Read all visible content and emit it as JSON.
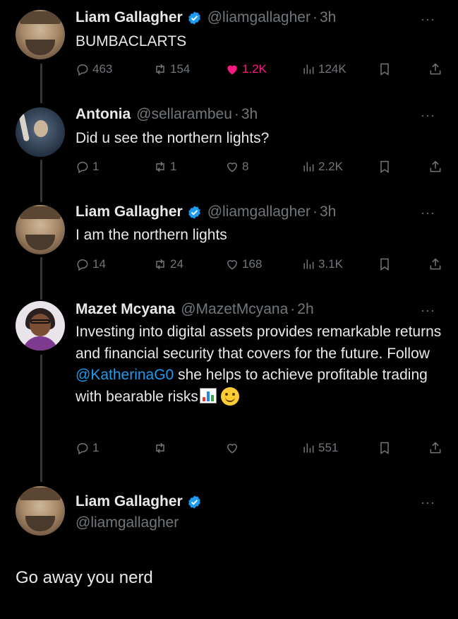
{
  "tweets": [
    {
      "name": "Liam Gallagher",
      "verified": true,
      "handle": "@liamgallagher",
      "time": "3h",
      "text": "BUMBACLARTS",
      "actions": {
        "replies": "463",
        "retweets": "154",
        "likes": "1.2K",
        "views": "124K",
        "liked": true
      }
    },
    {
      "name": "Antonia",
      "verified": false,
      "handle": "@sellarambeu",
      "time": "3h",
      "text": "Did u see the northern lights?",
      "actions": {
        "replies": "1",
        "retweets": "1",
        "likes": "8",
        "views": "2.2K",
        "liked": false
      }
    },
    {
      "name": "Liam Gallagher",
      "verified": true,
      "handle": "@liamgallagher",
      "time": "3h",
      "text": "I am the northern lights",
      "actions": {
        "replies": "14",
        "retweets": "24",
        "likes": "168",
        "views": "3.1K",
        "liked": false
      }
    },
    {
      "name": "Mazet Mcyana",
      "verified": false,
      "handle": "@MazetMcyana",
      "time": "2h",
      "text_before_link": "Investing into digital assets provides remarkable returns and financial security that covers for the future. Follow ",
      "link": "@KatherinaG0",
      "text_after_link": " she helps to achieve profitable trading with bearable risks",
      "emojis": [
        "chart-emoji",
        "smiling-face-emoji"
      ],
      "actions": {
        "replies": "1",
        "retweets": "",
        "likes": "",
        "views": "551",
        "liked": false
      }
    }
  ],
  "final_tweet": {
    "name": "Liam Gallagher",
    "verified": true,
    "handle": "@liamgallagher",
    "text": "Go away you nerd"
  },
  "more_label": "···",
  "dot": "·",
  "colors": {
    "background": "#000000",
    "text": "#e7e9ea",
    "secondary": "#71767b",
    "link": "#1d9bf0",
    "like": "#f91880",
    "verified": "#1d9bf0"
  }
}
